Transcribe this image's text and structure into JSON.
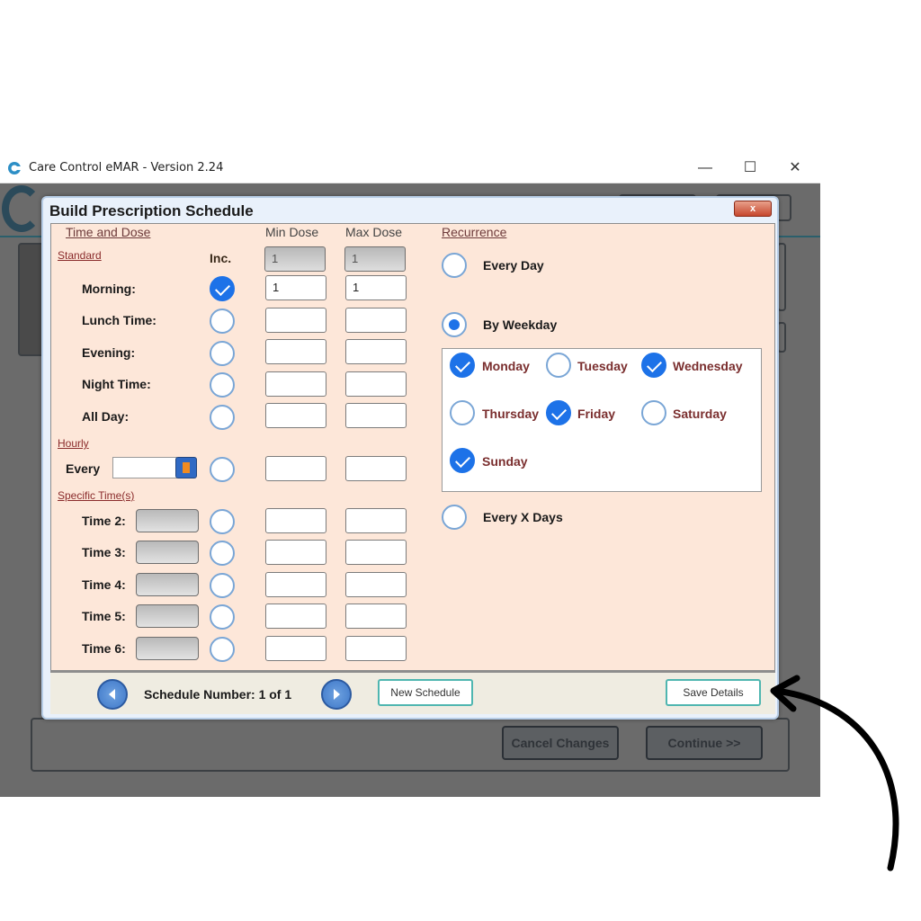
{
  "window": {
    "title": "Care Control eMAR - Version 2.24",
    "minimize_glyph": "—",
    "maximize_glyph": "☐",
    "close_glyph": "✕"
  },
  "background": {
    "cancel_label": "Cancel Changes",
    "continue_label": "Continue >>"
  },
  "modal": {
    "title": "Build Prescription Schedule",
    "close_glyph": "x",
    "time_and_dose_label": "Time and Dose",
    "min_dose_label": "Min Dose",
    "max_dose_label": "Max Dose",
    "recurrence_label": "Recurrence",
    "standard_label": "Standard",
    "inc_label": "Inc.",
    "header_min_value": "1",
    "header_max_value": "1",
    "standard_rows": [
      {
        "label": "Morning:",
        "checked": true,
        "min": "1",
        "max": "1"
      },
      {
        "label": "Lunch Time:",
        "checked": false,
        "min": "",
        "max": ""
      },
      {
        "label": "Evening:",
        "checked": false,
        "min": "",
        "max": ""
      },
      {
        "label": "Night Time:",
        "checked": false,
        "min": "",
        "max": ""
      },
      {
        "label": "All Day:",
        "checked": false,
        "min": "",
        "max": ""
      }
    ],
    "hourly_label": "Hourly",
    "every_label": "Every",
    "specific_label": "Specific Time(s)",
    "specific_rows": [
      {
        "label": "Time 2:"
      },
      {
        "label": "Time 3:"
      },
      {
        "label": "Time 4:"
      },
      {
        "label": "Time 5:"
      },
      {
        "label": "Time 6:"
      }
    ],
    "recurrence": {
      "every_day": "Every Day",
      "by_weekday": "By Weekday",
      "every_x_days": "Every X Days",
      "selected": "By Weekday",
      "days": [
        {
          "label": "Monday",
          "checked": true
        },
        {
          "label": "Tuesday",
          "checked": false
        },
        {
          "label": "Wednesday",
          "checked": true
        },
        {
          "label": "Thursday",
          "checked": false
        },
        {
          "label": "Friday",
          "checked": true
        },
        {
          "label": "Saturday",
          "checked": false
        },
        {
          "label": "Sunday",
          "checked": true
        }
      ]
    },
    "footer": {
      "schedule_number": "Schedule Number: 1 of 1",
      "new_schedule_label": "New Schedule",
      "save_details_label": "Save Details"
    }
  },
  "colors": {
    "accent": "#1d72e8",
    "panel": "#fde7d9",
    "annotation_arrow": "#000000"
  }
}
